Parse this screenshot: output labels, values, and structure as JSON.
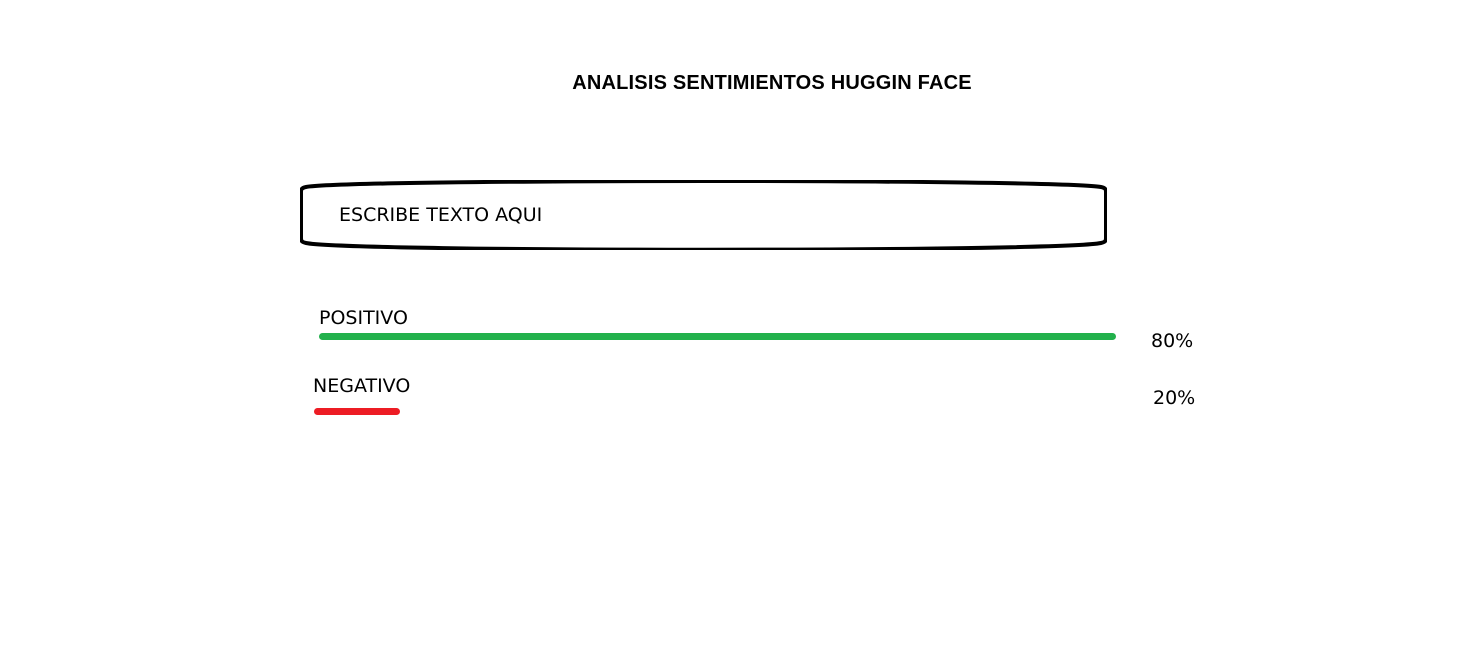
{
  "header": {
    "title": "ANALISIS SENTIMIENTOS HUGGIN FACE"
  },
  "input": {
    "placeholder": "ESCRIBE TEXTO AQUI",
    "value": ""
  },
  "results": {
    "positive": {
      "label": "POSITIVO",
      "percent_text": "80%",
      "fraction": 0.8,
      "color": "#22b14c"
    },
    "negative": {
      "label": "NEGATIVO",
      "percent_text": "20%",
      "fraction": 0.2,
      "color": "#ed1c24"
    }
  }
}
